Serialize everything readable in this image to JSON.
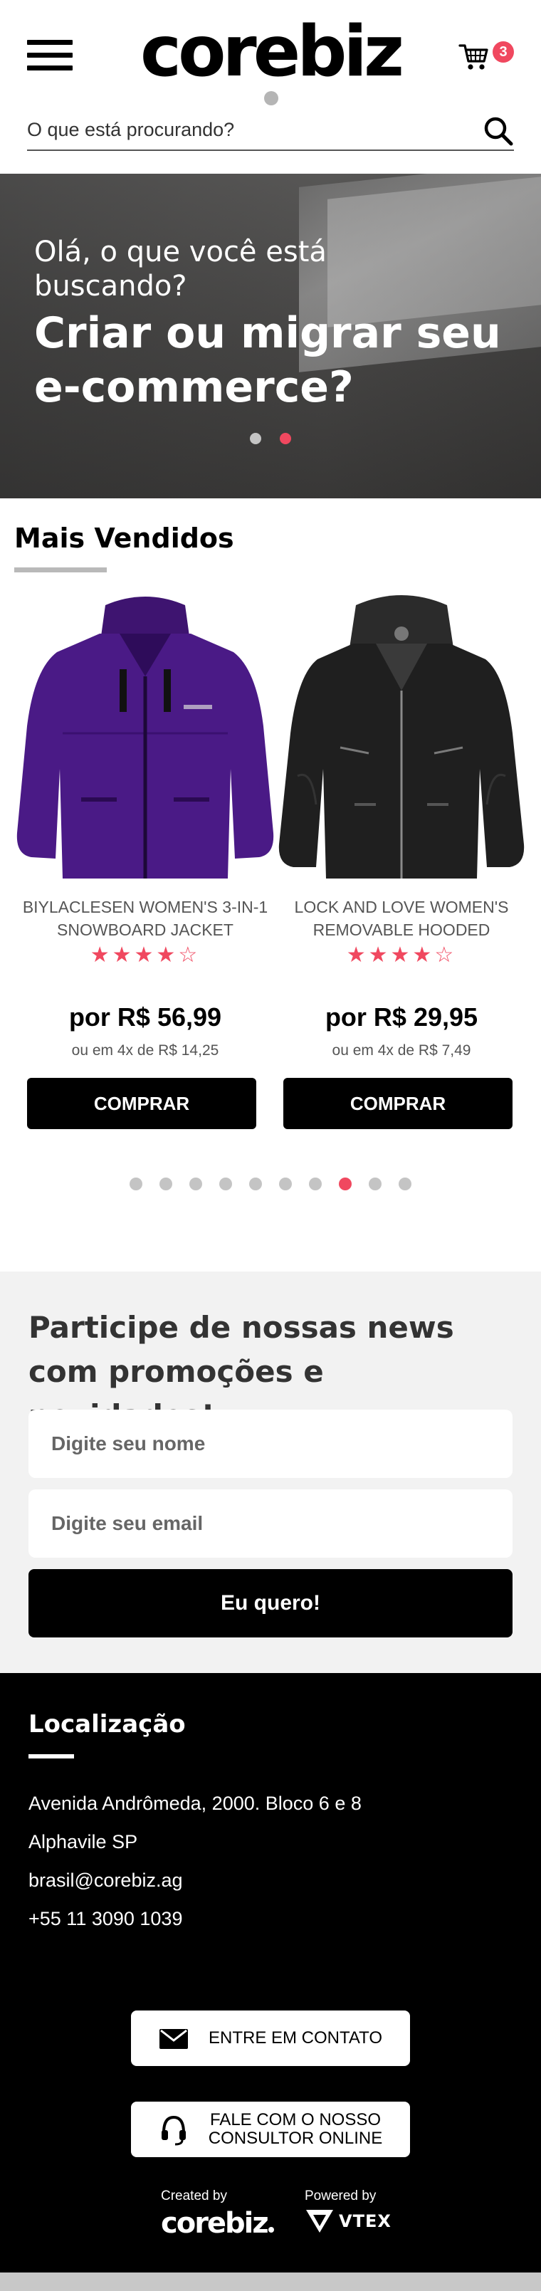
{
  "header": {
    "logo": "corebiz",
    "cart_count": "3",
    "search_placeholder": "O que está procurando?"
  },
  "banner": {
    "small_text": "Olá, o que você está buscando?",
    "big_text": "Criar ou migrar seu e-commerce?",
    "active_slide": 2,
    "slide_count": 2
  },
  "best_sellers": {
    "title": "Mais Vendidos",
    "products": [
      {
        "name": "BIYLACLESEN WOMEN'S 3-IN-1 SNOWBOARD JACKET",
        "rating": 4,
        "rating_max": 5,
        "price": "por R$ 56,99",
        "installments": "ou em 4x de R$ 14,25",
        "buy_label": "COMPRAR"
      },
      {
        "name": "LOCK AND LOVE WOMEN'S REMOVABLE HOODED",
        "rating": 4,
        "rating_max": 5,
        "price": "por R$ 29,95",
        "installments": "ou em 4x de R$ 7,49",
        "buy_label": "COMPRAR"
      }
    ],
    "pagination_count": 10,
    "pagination_active": 8
  },
  "newsletter": {
    "title": "Participe de nossas news com promoções e novidades!",
    "name_placeholder": "Digite seu nome",
    "email_placeholder": "Digite seu email",
    "submit_label": "Eu quero!"
  },
  "footer": {
    "title": "Localização",
    "address": "Avenida Andrômeda, 2000. Bloco 6 e 8",
    "city": "Alphavile SP",
    "email": "brasil@corebiz.ag",
    "phone": "+55 11 3090 1039",
    "contact_button": "ENTRE EM CONTATO",
    "consultant_button": "FALE COM O NOSSO CONSULTOR ONLINE",
    "created_by": "Created by",
    "created_logo": "corebiz",
    "powered_by": "Powered by",
    "powered_logo": "VTEX"
  },
  "colors": {
    "accent": "#f0485f",
    "dark": "#000000",
    "newsletter_bg": "#f2f2f2",
    "dot_inactive": "#c4c4c4"
  },
  "icons": [
    "menu-icon",
    "cart-icon",
    "search-icon",
    "mail-icon",
    "headset-icon",
    "vtex-logo-icon"
  ]
}
